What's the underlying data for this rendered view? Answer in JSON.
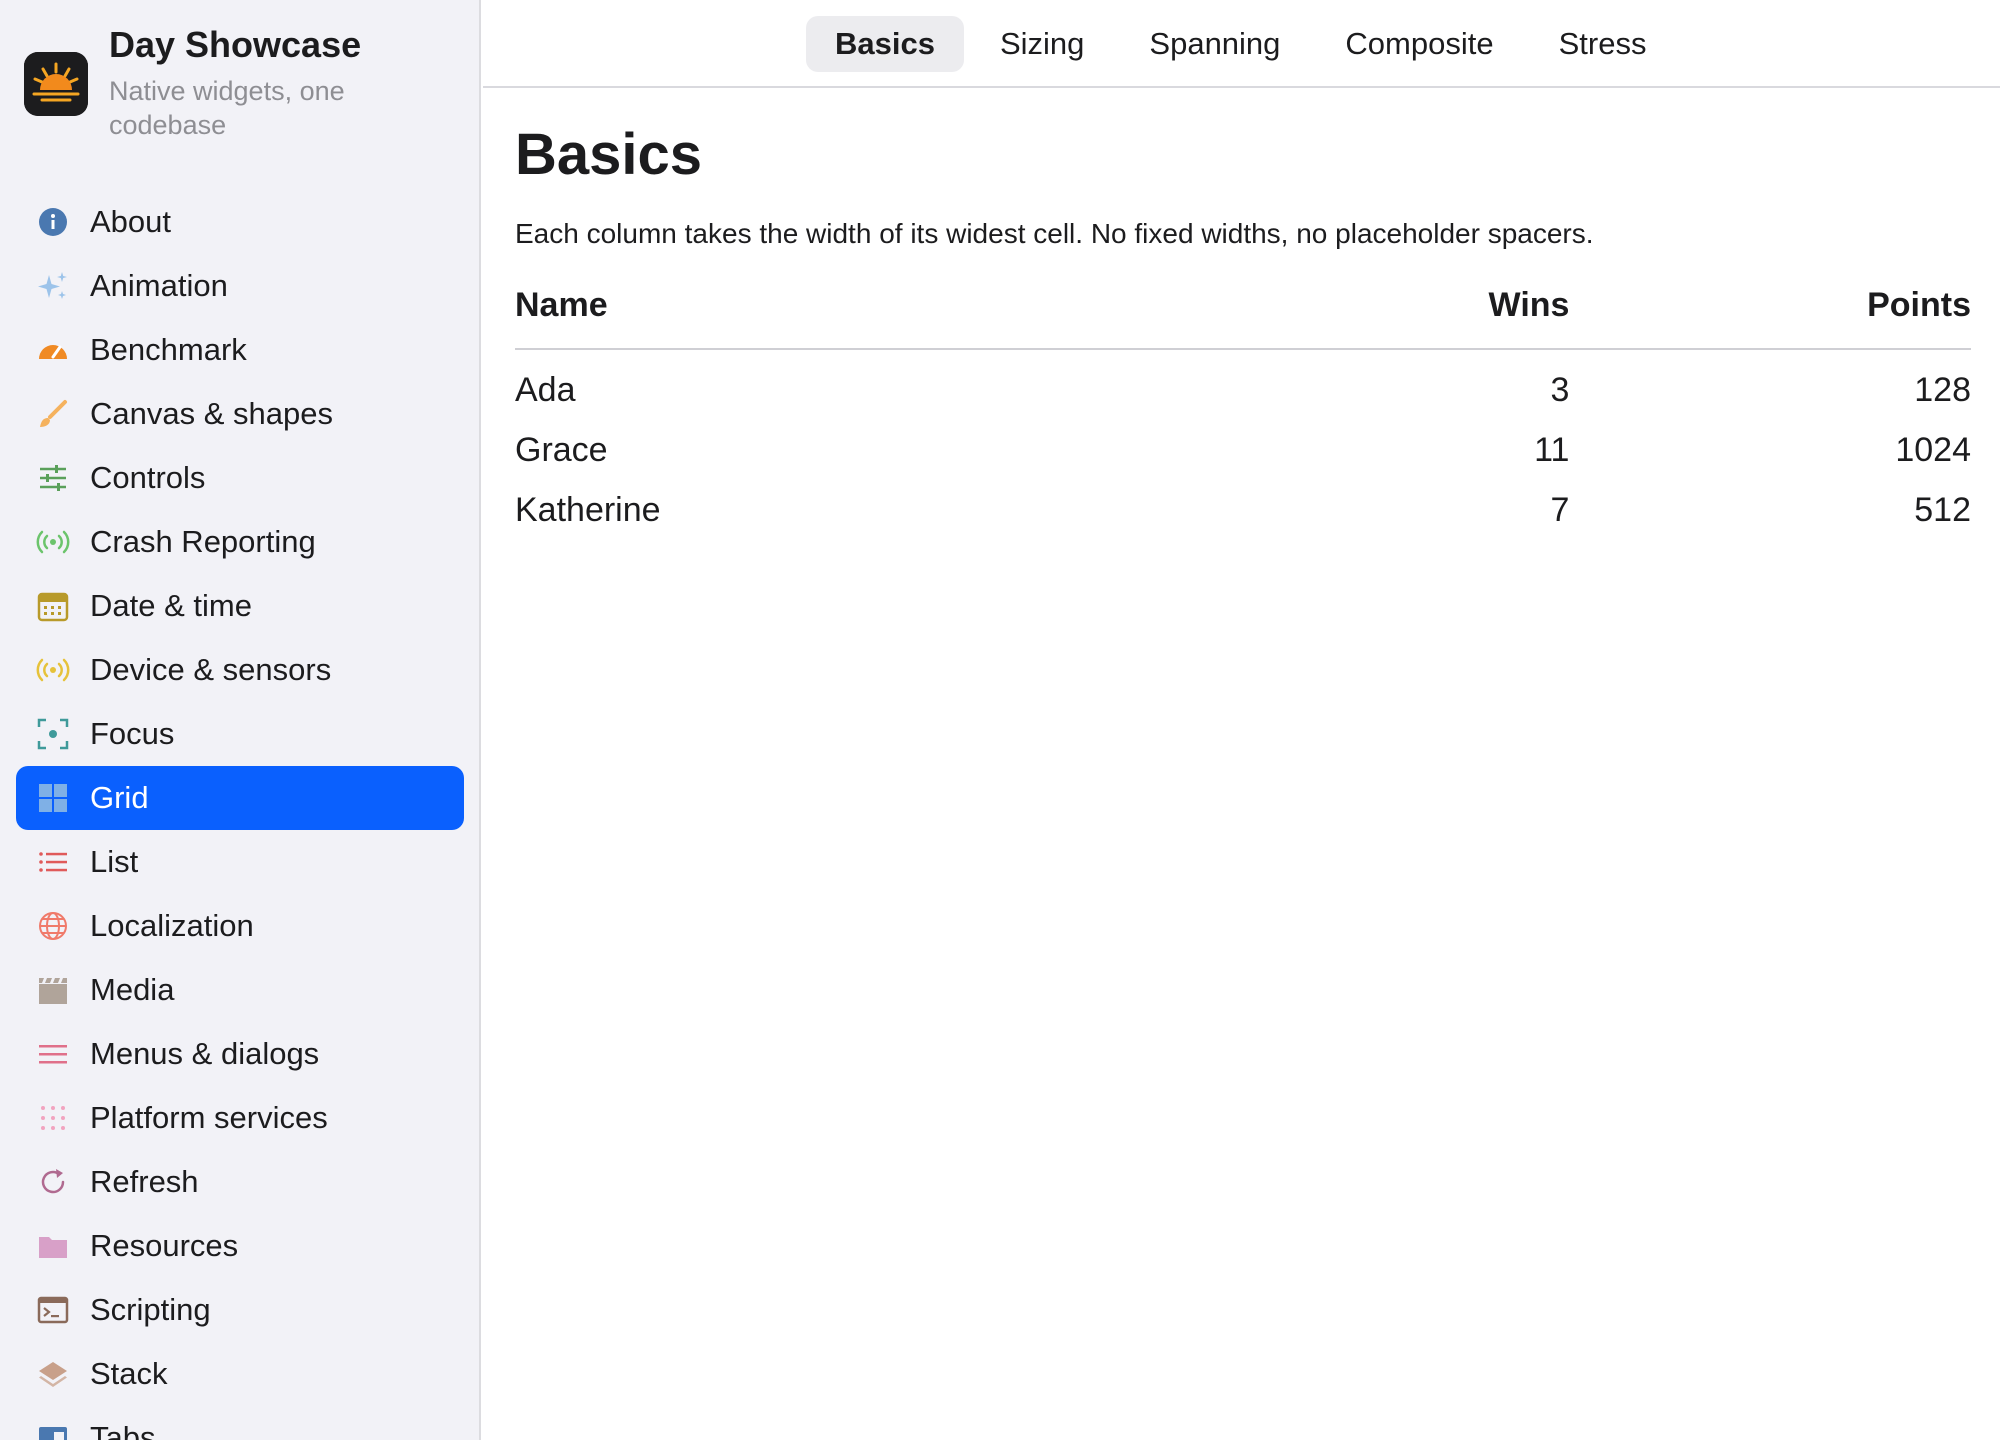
{
  "app": {
    "title": "Day Showcase",
    "subtitle": "Native widgets, one codebase"
  },
  "sidebar": {
    "items": [
      {
        "label": "About",
        "icon": "info-icon",
        "color": "#4a78b0"
      },
      {
        "label": "Animation",
        "icon": "sparkles-icon",
        "color": "#9cc3ea"
      },
      {
        "label": "Benchmark",
        "icon": "gauge-icon",
        "color": "#f08a24"
      },
      {
        "label": "Canvas & shapes",
        "icon": "brush-icon",
        "color": "#f5b25e"
      },
      {
        "label": "Controls",
        "icon": "sliders-icon",
        "color": "#5aa05a"
      },
      {
        "label": "Crash Reporting",
        "icon": "broadcast-icon",
        "color": "#6cc46c"
      },
      {
        "label": "Date & time",
        "icon": "calendar-icon",
        "color": "#b89a2a"
      },
      {
        "label": "Device & sensors",
        "icon": "broadcast-icon",
        "color": "#e6c23a"
      },
      {
        "label": "Focus",
        "icon": "focus-icon",
        "color": "#3f9a9a"
      },
      {
        "label": "Grid",
        "icon": "grid-icon",
        "color": "#7fb0e6"
      },
      {
        "label": "List",
        "icon": "list-icon",
        "color": "#e05a5a"
      },
      {
        "label": "Localization",
        "icon": "globe-icon",
        "color": "#f07a6a"
      },
      {
        "label": "Media",
        "icon": "clapper-icon",
        "color": "#b0a49a"
      },
      {
        "label": "Menus & dialogs",
        "icon": "menu-icon",
        "color": "#e0708a"
      },
      {
        "label": "Platform services",
        "icon": "dots-icon",
        "color": "#f2a4c0"
      },
      {
        "label": "Refresh",
        "icon": "refresh-icon",
        "color": "#b06a90"
      },
      {
        "label": "Resources",
        "icon": "folder-icon",
        "color": "#d8a0c8"
      },
      {
        "label": "Scripting",
        "icon": "terminal-icon",
        "color": "#8a6a5a"
      },
      {
        "label": "Stack",
        "icon": "stack-icon",
        "color": "#c8a08a"
      },
      {
        "label": "Tabs",
        "icon": "tabs-icon",
        "color": "#4a78b0"
      }
    ],
    "active_index": 9
  },
  "tabs": [
    "Basics",
    "Sizing",
    "Spanning",
    "Composite",
    "Stress"
  ],
  "active_tab": "Basics",
  "page": {
    "title": "Basics",
    "description": "Each column takes the width of its widest cell. No fixed widths, no placeholder spacers."
  },
  "table": {
    "headers": [
      "Name",
      "Wins",
      "Points"
    ],
    "rows": [
      [
        "Ada",
        "3",
        "128"
      ],
      [
        "Grace",
        "11",
        "1024"
      ],
      [
        "Katherine",
        "7",
        "512"
      ]
    ]
  },
  "colors": {
    "accent": "#0a60fe",
    "sidebar_bg": "#f2f2f7",
    "tab_active_bg": "#ececef"
  }
}
